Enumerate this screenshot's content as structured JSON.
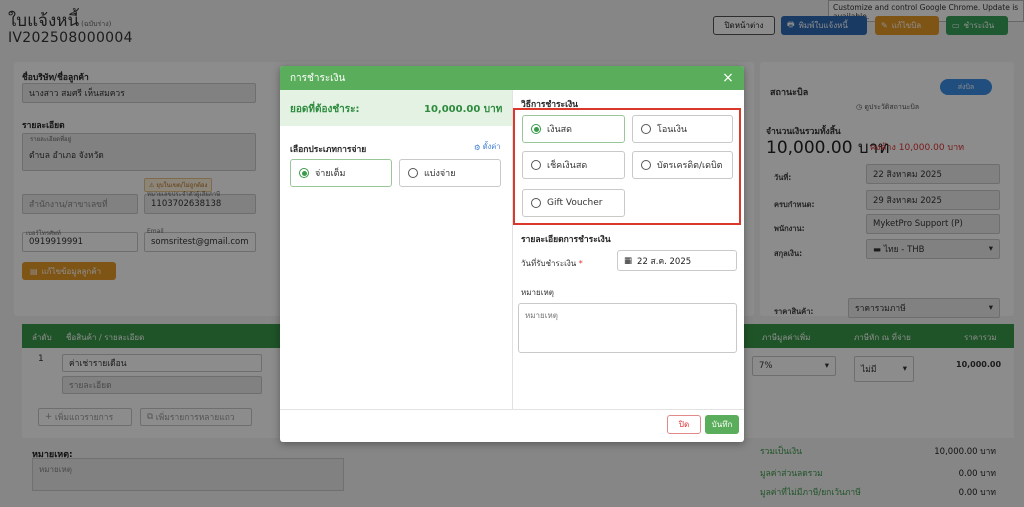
{
  "tooltip": {
    "text": "Customize and control Google Chrome. Update is available."
  },
  "page": {
    "title": "ใบแจ้งหนี้",
    "title_note": "(ฉบับร่าง)",
    "number": "IV202508000004",
    "close_window": "ปิดหน้าต่าง",
    "print": "พิมพ์ใบแจ้งหนี้",
    "edit": "แก้ไขบิล",
    "pay": "ชำระเงิน"
  },
  "customer": {
    "company_label": "ชื่อบริษัท/ชื่อลูกค้า",
    "company_value": "นางสาว สมศรี เห็นสมควร",
    "details_label": "รายละเอียด",
    "address_label": "รายละเอียดที่อยู่",
    "address_value": "ตำบล อำเภอ จังหวัด",
    "branch_placeholder": "สำนักงาน/สาขาเลขที่",
    "taxid_label": "หมายเลขประจำตัวผู้เสียภาษี",
    "taxid_value": "1103702638138",
    "phone_label": "เบอร์โทรศัพท์",
    "phone_value": "0919919991",
    "email_label": "Email",
    "email_value": "somsritest@gmail.com",
    "warning_tag": "ยุบในเขต/ไม่ถูกต้อง",
    "edit_customer": "แก้ไขข้อมูลลูกค้า"
  },
  "status": {
    "label": "สถานะบิล",
    "value": "ส่งบิล",
    "history": "ดูประวัติสถานะบิล",
    "total_label": "จำนวนเงินรวมทั้งสิ้น",
    "total_amount": "10,000.00 บาท",
    "remaining": "คงค้าง 10,000.00 บาท",
    "date_label": "วันที่:",
    "date_value": "22 สิงหาคม 2025",
    "due_label": "ครบกำหนด:",
    "due_value": "29 สิงหาคม 2025",
    "staff_label": "พนักงาน:",
    "staff_value": "MyketPro Support (P)",
    "currency_label": "สกุลเงิน:",
    "currency_value": "ไทย - THB",
    "price_label": "ราคาสินค้า:",
    "price_value": "ราคารวมภาษี"
  },
  "table": {
    "headers": [
      "ลำดับ",
      "ชื่อสินค้า / รายละเอียด",
      "ภาษีมูลค่าเพิ่ม",
      "ภาษีหัก ณ ที่จ่าย",
      "ราคารวม"
    ],
    "row": {
      "index": "1",
      "item": "ค่าเช่ารายเดือน",
      "detail_placeholder": "รายละเอียด",
      "vat": "7%",
      "wht": "ไม่มี",
      "total": "10,000.00"
    },
    "add_row": "เพิ่มแถวรายการ",
    "add_multi": "เพิ่มรายการหลายแถว"
  },
  "notes": {
    "label": "หมายเหตุ:",
    "placeholder": "หมายเหตุ"
  },
  "summary": {
    "total_label": "รวมเป็นเงิน",
    "total_value": "10,000.00 บาท",
    "discount_label": "มูลค่าส่วนลดรวม",
    "discount_value": "0.00 บาท",
    "exempt_label": "มูลค่าที่ไม่มีภาษี/ยกเว้นภาษี",
    "exempt_value": "0.00 บาท"
  },
  "modal": {
    "title": "การชำระเงิน",
    "amount_label": "ยอดที่ต้องชำระ:",
    "amount_value": "10,000.00 บาท",
    "pay_type_label": "เลือกประเภทการจ่าย",
    "settings": "ตั้งค่า",
    "pay_full": "จ่ายเต็ม",
    "pay_split": "แบ่งจ่าย",
    "method_label": "วิธีการชำระเงิน",
    "methods": [
      "เงินสด",
      "โอนเงิน",
      "เช็คเงินสด",
      "บัตรเครดิต/เดบิต",
      "Gift Voucher"
    ],
    "detail_label": "รายละเอียดการชำระเงิน",
    "date_label": "วันที่รับชำระเงิน",
    "date_required": "*",
    "date_value": "22 ส.ค. 2025",
    "remark_label": "หมายเหตุ",
    "remark_placeholder": "หมายเหตุ",
    "cancel": "ปิด",
    "save": "บันทึก"
  },
  "colors": {
    "primary_green": "#5aad5a",
    "highlight_red": "#d9382a",
    "link_blue": "#3a7bd5"
  }
}
